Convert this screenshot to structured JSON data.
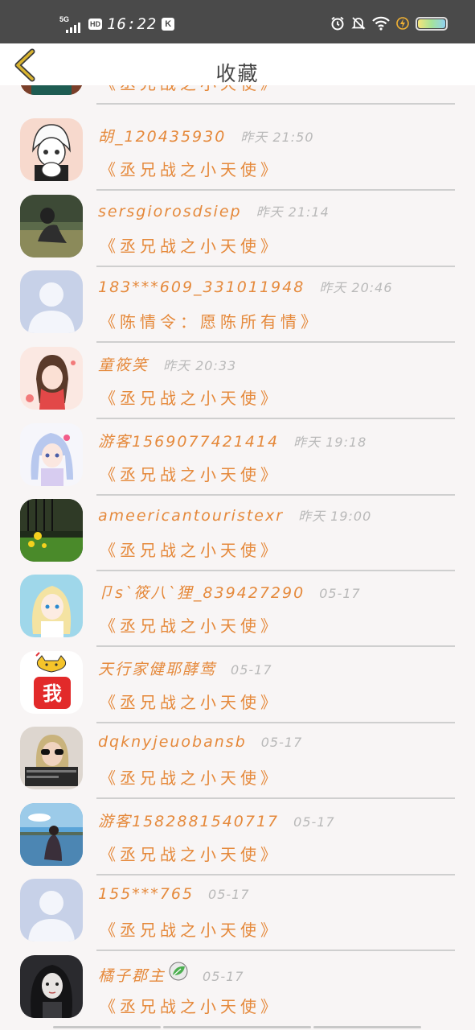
{
  "status_bar": {
    "network": "5G",
    "hd": "HD",
    "time": "16:22",
    "k_badge": "K",
    "icons": [
      "alarm-icon",
      "silent-bell-icon",
      "wifi-icon",
      "charging-icon",
      "battery-icon"
    ]
  },
  "header": {
    "back_icon": "chevron-left-icon",
    "title": "收藏"
  },
  "items": [
    {
      "name": "",
      "time": "",
      "book": "《丞兄战之小天使》",
      "avatar": "photo-girl"
    },
    {
      "name": "胡_120435930",
      "time": "昨天 21:50",
      "book": "《丞兄战之小天使》",
      "avatar": "anime-white-hair"
    },
    {
      "name": "sersgiorosdsiep",
      "time": "昨天 21:14",
      "book": "《丞兄战之小天使》",
      "avatar": "photo-field"
    },
    {
      "name": "183***609_331011948",
      "time": "昨天 20:46",
      "book": "《陈情令：愿陈所有情》",
      "avatar": "default-user"
    },
    {
      "name": "童筱笑",
      "time": "昨天 20:33",
      "book": "《丞兄战之小天使》",
      "avatar": "anime-girl-scarf"
    },
    {
      "name": "游客1569077421414",
      "time": "昨天 19:18",
      "book": "《丞兄战之小天使》",
      "avatar": "anime-blue-hair"
    },
    {
      "name": "ameericantouristexr",
      "time": "昨天 19:00",
      "book": "《丞兄战之小天使》",
      "avatar": "photo-flowers"
    },
    {
      "name": "卩s`筱八`狸_839427290",
      "time": "05-17",
      "book": "《丞兄战之小天使》",
      "avatar": "anime-blonde"
    },
    {
      "name": "天行家健耶酵莺",
      "time": "05-17",
      "book": "《丞兄战之小天使》",
      "avatar": "cat-wo"
    },
    {
      "name": "dqknyjeuobansb",
      "time": "05-17",
      "book": "《丞兄战之小天使》",
      "avatar": "photo-sunglasses"
    },
    {
      "name": "游客1582881540717",
      "time": "05-17",
      "book": "《丞兄战之小天使》",
      "avatar": "photo-lake"
    },
    {
      "name": "155***765",
      "time": "05-17",
      "book": "《丞兄战之小天使》",
      "avatar": "default-user"
    },
    {
      "name": "橘子郡主",
      "time": "05-17",
      "book": "《丞兄战之小天使》",
      "avatar": "photo-dark-girl"
    }
  ],
  "avatar_text": {
    "wo": "我"
  },
  "colors": {
    "accent": "#e5893b",
    "time_gray": "#b9b9b9",
    "status_bar_bg": "#4a4a4a",
    "page_bg": "#f8f5f5",
    "back_arrow": "#c9a21c"
  }
}
